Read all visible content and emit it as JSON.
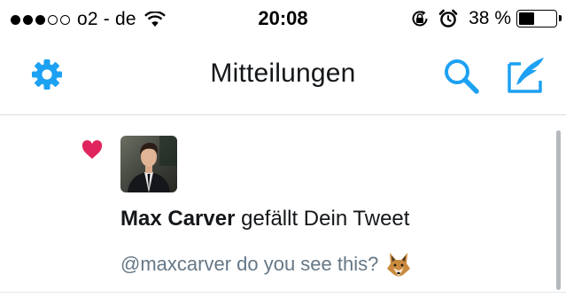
{
  "status_bar": {
    "signal_full": 3,
    "signal_total": 5,
    "carrier": "o2 - de",
    "time": "20:08",
    "battery_percent": "38 %",
    "battery_level": 0.38,
    "icons": [
      "wifi-icon",
      "rotation-lock-icon",
      "alarm-icon",
      "battery-icon"
    ]
  },
  "nav": {
    "title": "Mitteilungen",
    "accent_color": "#1da1f2",
    "icons": [
      "gear-icon",
      "search-icon",
      "compose-icon"
    ]
  },
  "notification": {
    "icon": "heart-icon",
    "heart_color": "#e0245e",
    "user_name": "Max Carver",
    "action": " gefällt Dein Tweet",
    "tweet_text": "@maxcarver do you see this?",
    "emoji": "fox-emoji"
  }
}
